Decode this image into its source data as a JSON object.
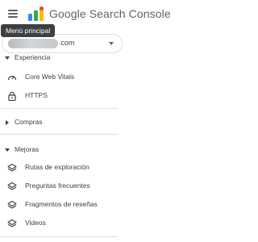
{
  "header": {
    "brand": "Google Search Console",
    "menu_tooltip": "Menú principal"
  },
  "property_selector": {
    "domain_suffix": ".com"
  },
  "nav": {
    "experiencia": {
      "label": "Experiencia",
      "items": [
        {
          "label": "Core Web Vitals",
          "icon": "gauge-icon"
        },
        {
          "label": "HTTPS",
          "icon": "lock-icon"
        }
      ]
    },
    "compras": {
      "label": "Compras"
    },
    "mejoras": {
      "label": "Mejoras",
      "items": [
        {
          "label": "Rutas de exploración",
          "icon": "layers-icon"
        },
        {
          "label": "Preguntas frecuentes",
          "icon": "layers-icon"
        },
        {
          "label": "Fragmentos de reseñas",
          "icon": "layers-icon"
        },
        {
          "label": "Videos",
          "icon": "layers-icon"
        }
      ]
    }
  },
  "colors": {
    "text": "#3c4043",
    "icon": "#5f6368",
    "tooltip_bg": "#3c4043",
    "divider": "#e0e0e0"
  }
}
